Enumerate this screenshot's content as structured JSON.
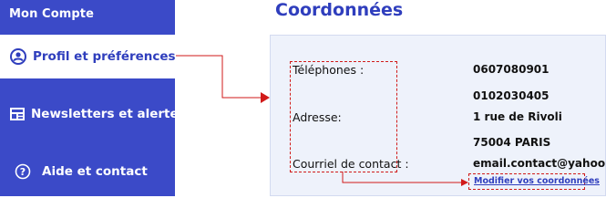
{
  "sidebar": {
    "title": "Mon Compte",
    "items": [
      {
        "label": "Profil et préférences",
        "icon": "profile-icon"
      },
      {
        "label": "Newsletters et alertes",
        "icon": "newsletter-icon"
      },
      {
        "label": "Aide et contact",
        "icon": "help-icon"
      }
    ]
  },
  "panel": {
    "title": "Coordonnées",
    "labels": {
      "phones": "Téléphones :",
      "address": "Adresse:",
      "email": "Courriel de contact :"
    },
    "values": {
      "phone1": "0607080901",
      "phone2": "0102030405",
      "address1": "1 rue de Rivoli",
      "address2": "75004 PARIS",
      "email": "email.contact@yahoo.fr"
    },
    "edit_link": "Modifier vos coordonnées"
  },
  "colors": {
    "sidebar_bg": "#3b4ac8",
    "accent": "#2f3ebd",
    "annotation_red": "#d11a1a",
    "panel_body_bg": "#eef2fb"
  }
}
